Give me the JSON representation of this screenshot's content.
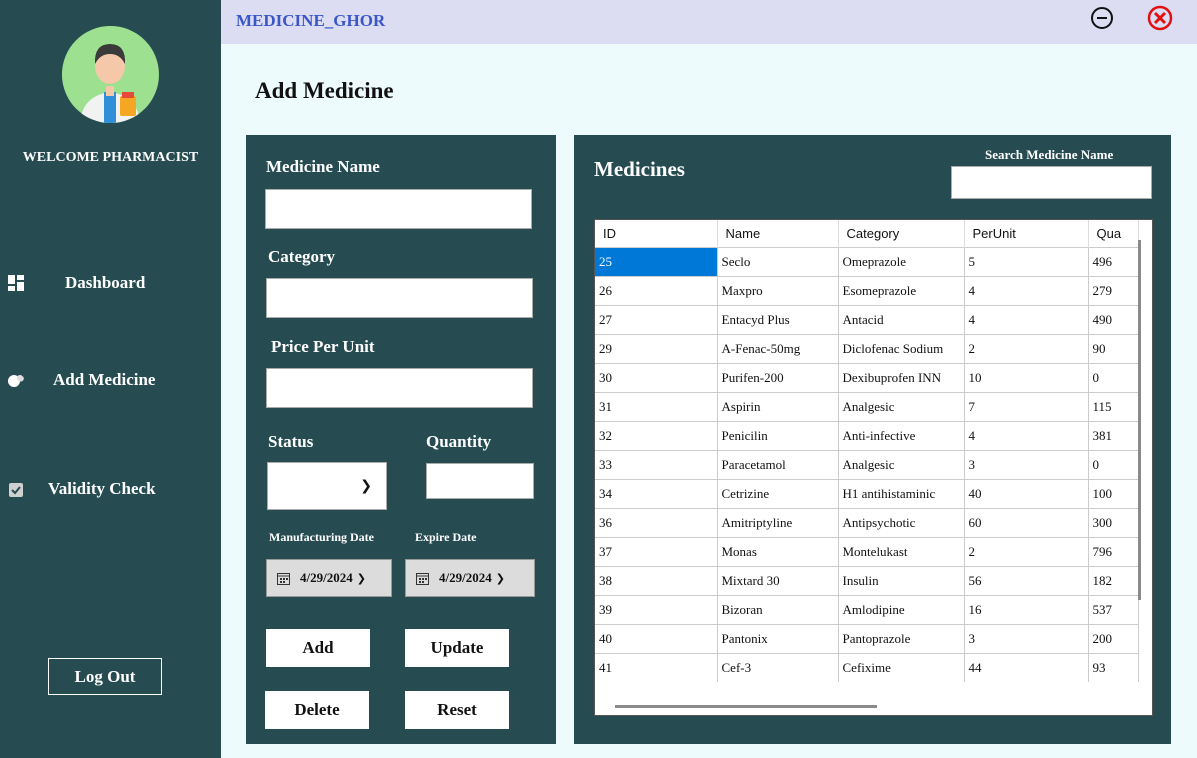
{
  "app": {
    "title": "MEDICINE_GHOR"
  },
  "sidebar": {
    "welcome": "WELCOME PHARMACIST",
    "items": [
      {
        "label": "Dashboard",
        "icon": "dashboard-icon"
      },
      {
        "label": "Add Medicine",
        "icon": "pills-icon"
      },
      {
        "label": "Validity Check",
        "icon": "check-calendar-icon"
      }
    ],
    "logout": "Log Out"
  },
  "page": {
    "title": "Add Medicine"
  },
  "form": {
    "medicine_name_label": "Medicine Name",
    "category_label": "Category",
    "price_label": "Price Per Unit",
    "status_label": "Status",
    "quantity_label": "Quantity",
    "mfg_date_label": "Manufacturing Date",
    "exp_date_label": "Expire Date",
    "mfg_date": "4/29/2024",
    "exp_date": "4/29/2024",
    "add": "Add",
    "update": "Update",
    "delete": "Delete",
    "reset": "Reset"
  },
  "table": {
    "title": "Medicines",
    "search_label": "Search Medicine Name",
    "columns": [
      "ID",
      "Name",
      "Category",
      "PerUnit",
      "Qua"
    ],
    "rows": [
      [
        "25",
        "Seclo",
        "Omeprazole",
        "5",
        "496"
      ],
      [
        "26",
        "Maxpro",
        "Esomeprazole",
        "4",
        "279"
      ],
      [
        "27",
        "Entacyd Plus",
        "Antacid",
        "4",
        "490"
      ],
      [
        "29",
        "A-Fenac-50mg",
        "Diclofenac Sodium",
        "2",
        "90"
      ],
      [
        "30",
        "Purifen-200",
        "Dexibuprofen INN",
        "10",
        "0"
      ],
      [
        "31",
        "Aspirin",
        "Analgesic",
        "7",
        "115"
      ],
      [
        "32",
        "Penicilin",
        "Anti-infective",
        "4",
        "381"
      ],
      [
        "33",
        "Paracetamol",
        "Analgesic",
        "3",
        "0"
      ],
      [
        "34",
        "Cetrizine",
        "H1 antihistaminic",
        "40",
        "100"
      ],
      [
        "36",
        "Amitriptyline",
        "Antipsychotic",
        "60",
        "300"
      ],
      [
        "37",
        "Monas",
        "Montelukast",
        "2",
        "796"
      ],
      [
        "38",
        "Mixtard 30",
        "Insulin",
        "56",
        "182"
      ],
      [
        "39",
        "Bizoran",
        "Amlodipine",
        "16",
        "537"
      ],
      [
        "40",
        "Pantonix",
        "Pantoprazole",
        "3",
        "200"
      ],
      [
        "41",
        "Cef-3",
        "Cefixime",
        "44",
        "93"
      ]
    ]
  },
  "colors": {
    "panel": "#264c52",
    "titlebar": "#dcdcf3",
    "accent": "#3a57c8",
    "selection": "#0078d7",
    "close": "#e01010"
  }
}
